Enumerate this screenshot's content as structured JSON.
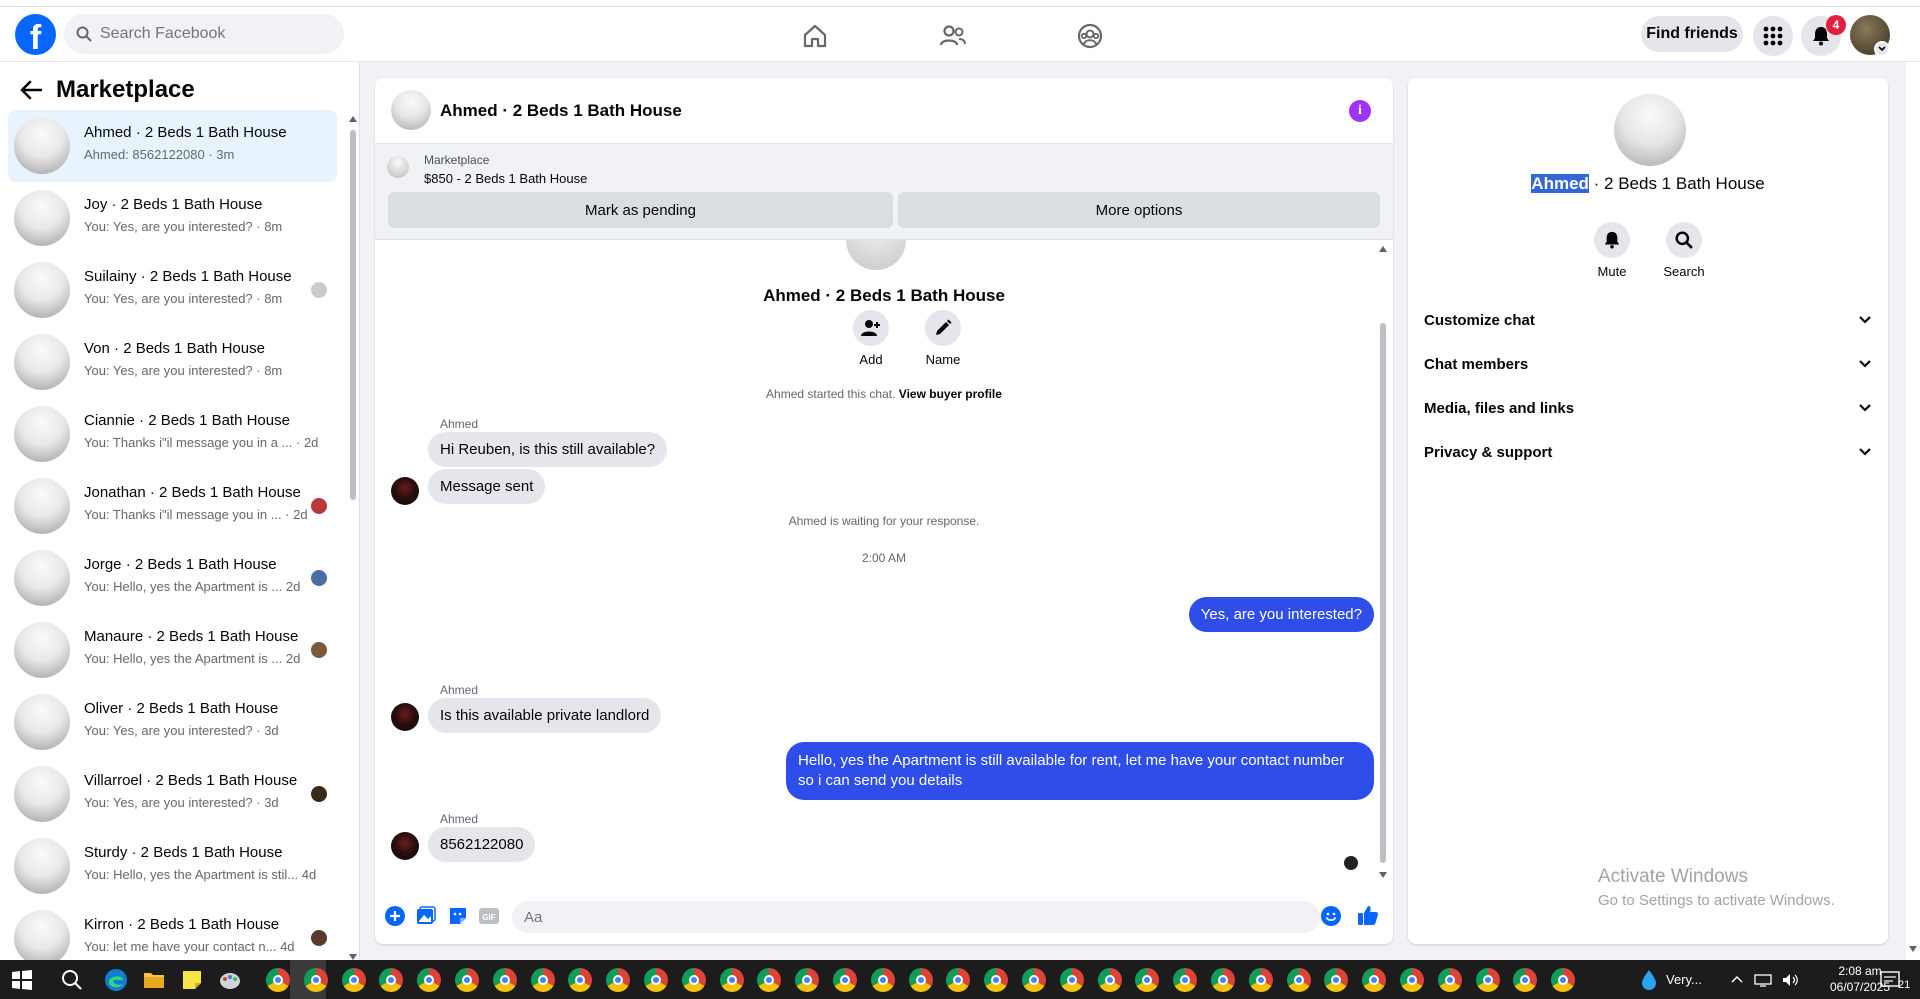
{
  "nav": {
    "logo": "f",
    "search_placeholder": "Search Facebook",
    "find_friends": "Find friends",
    "notif_count": "4"
  },
  "sidebar": {
    "title": "Marketplace",
    "conversations": [
      {
        "title": "Ahmed · 2 Beds 1 Bath House",
        "sub": "Ahmed: 8562122080 · 3m",
        "mini": ""
      },
      {
        "title": "Joy · 2 Beds 1 Bath House",
        "sub": "You: Yes, are you interested? · 8m",
        "mini": ""
      },
      {
        "title": "Suilainy · 2 Beds 1 Bath House",
        "sub": "You: Yes, are you interested? · 8m",
        "mini": "#c8ccd1"
      },
      {
        "title": "Von · 2 Beds 1 Bath House",
        "sub": "You: Yes, are you interested? · 8m",
        "mini": ""
      },
      {
        "title": "Ciannie · 2 Beds 1 Bath House",
        "sub": "You: Thanks i\"il message you in a ...  · 2d",
        "mini": ""
      },
      {
        "title": "Jonathan · 2 Beds 1 Bath House",
        "sub": "You: Thanks i\"il message you in ... · 2d",
        "mini": "#b83a3a"
      },
      {
        "title": "Jorge · 2 Beds 1 Bath House",
        "sub": "You: Hello, yes the Apartment is ...  2d",
        "mini": "#4a6fa5"
      },
      {
        "title": "Manaure · 2 Beds 1 Bath House",
        "sub": "You: Hello, yes the Apartment is ...  2d",
        "mini": "#7a5a3a"
      },
      {
        "title": "Oliver · 2 Beds 1 Bath House",
        "sub": "You: Yes, are you interested? · 3d",
        "mini": ""
      },
      {
        "title": "Villarroel · 2 Beds 1 Bath House",
        "sub": "You: Yes, are you interested? · 3d",
        "mini": "#3a2a1a"
      },
      {
        "title": "Sturdy · 2 Beds 1 Bath House",
        "sub": "You: Hello, yes the Apartment is stil...  4d",
        "mini": ""
      },
      {
        "title": "Kirron · 2 Beds 1 Bath House",
        "sub": "You: let me have your contact n...  4d",
        "mini": "#5a3a2a"
      }
    ]
  },
  "chat": {
    "header_name": "Ahmed · 2 Beds 1 Bath House",
    "marketplace_label": "Marketplace",
    "listing": "$850 - 2 Beds 1 Bath House",
    "mark_pending": "Mark as pending",
    "more_options": "More options",
    "center_title": "Ahmed · 2 Beds 1 Bath House",
    "add_label": "Add",
    "name_label": "Name",
    "started_text": "Ahmed started this chat.",
    "view_buyer": "View buyer profile",
    "sender1": "Ahmed",
    "msg1": "Hi Reuben, is this still available?",
    "msg2": "Message sent",
    "waiting": "Ahmed is waiting for your response.",
    "time": "2:00 AM",
    "out1": "Yes, are you interested?",
    "sender2": "Ahmed",
    "msg3": "Is this available private landlord",
    "out2": "Hello, yes the Apartment is still available for rent, let me have your contact number so i can send you details",
    "sender3": "Ahmed",
    "msg4": "8562122080",
    "composer_placeholder": "Aa"
  },
  "rpanel": {
    "name_highlight": "Ahmed",
    "name_rest": " · 2 Beds 1 Bath House",
    "mute": "Mute",
    "search": "Search",
    "sections": [
      "Customize chat",
      "Chat members",
      "Media, files and links",
      "Privacy & support"
    ],
    "watermark_title": "Activate Windows",
    "watermark_sub": "Go to Settings to activate Windows."
  },
  "taskbar": {
    "weather": "Very...",
    "time": "2:08 am",
    "date": "06/07/2025",
    "notif": "21"
  },
  "colors": {
    "brand": "#0866ff",
    "outgoing": "#2f4de8",
    "info": "#a033ff",
    "badge": "#e41e3f"
  }
}
